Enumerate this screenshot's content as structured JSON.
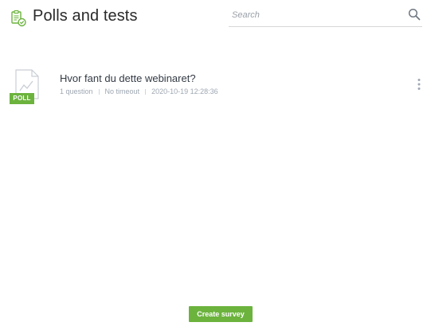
{
  "header": {
    "title": "Polls and tests",
    "icon": "clipboard-check-icon"
  },
  "search": {
    "placeholder": "Search",
    "value": ""
  },
  "polls": [
    {
      "badge": "POLL",
      "title": "Hvor fant du dette webinaret?",
      "questions": "1 question",
      "timeout": "No timeout",
      "created": "2020-10-19 12:28:36"
    }
  ],
  "actions": {
    "create_label": "Create survey"
  },
  "colors": {
    "accent": "#6cb33e",
    "meta_text": "#9ea7b2",
    "title_text": "#2a2a2a"
  }
}
